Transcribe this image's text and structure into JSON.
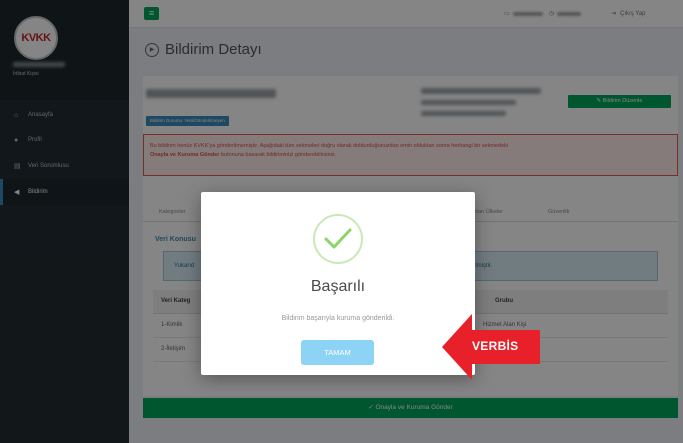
{
  "sidebar": {
    "logo_text": "KVKK",
    "user_role": "İrtibat Kişisi",
    "items": [
      {
        "label": "Anasayfa",
        "icon": "home-icon"
      },
      {
        "label": "Profil",
        "icon": "user-icon"
      },
      {
        "label": "Veri Sorumlusu",
        "icon": "database-icon"
      },
      {
        "label": "Bildirim",
        "icon": "bullhorn-icon"
      }
    ],
    "active_index": 3
  },
  "header": {
    "logout_label": "Çıkış Yap"
  },
  "page": {
    "title": "Bildirim Detayı"
  },
  "content": {
    "status_badge": "Bildirim Durumu: Yeni/Gönderilmeyen",
    "edit_button": "Bildirim Düzenle",
    "alert_line1": "Bu bildirim henüz KVKK'ya gönderilmemiştir. Aşağıdaki tüm sekmeleri doğru olarak doldurduğunuzdan emin olduktan sonra herhangi bir sekmedeki",
    "alert_bold": "Onayla ve Kuruma Gönder",
    "alert_line2": " butonuna basarak bildiriminizi gönderebilirsiniz.",
    "tabs": [
      "Kategoriler",
      "Aktarı Ülkeler",
      "Güvenlik"
    ],
    "section_title": "Veri Konusu",
    "info_left": "Yukarıd",
    "info_right": "rilmiştir.",
    "table_headers": [
      "Veri Kateg",
      "Grubu"
    ],
    "rows": [
      {
        "col1": "1-Kimlik",
        "col2": "Hizmet Alan Kişi"
      },
      {
        "col1": "2-İletişim",
        "col2": ""
      }
    ],
    "submit_label": "✓ Onayla ve Kuruma Gönder"
  },
  "modal": {
    "title": "Başarılı",
    "message": "Bildirim başarıyla kuruma gönderildi.",
    "button": "TAMAM"
  },
  "annotation": {
    "label": "VERBİS",
    "color": "#e8202a"
  },
  "colors": {
    "sidebar": "#222d32",
    "accent_green": "#00a65a",
    "accent_blue": "#3c8dbc",
    "alert_red": "#d9534f"
  }
}
